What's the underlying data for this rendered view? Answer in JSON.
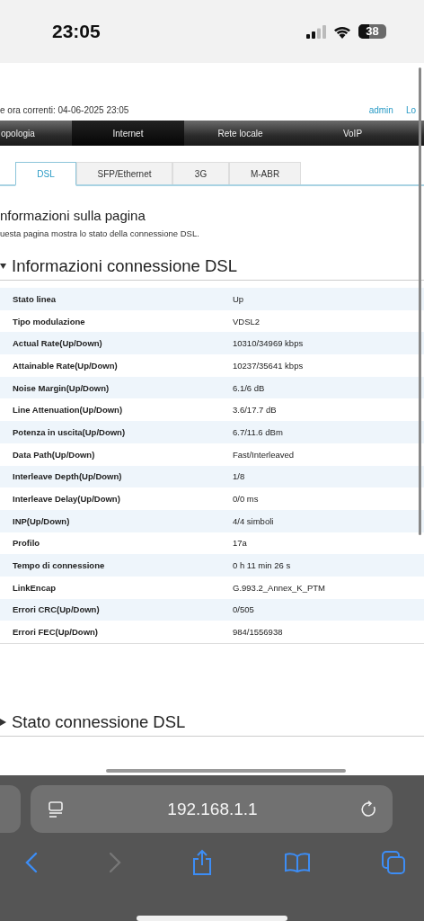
{
  "status_bar": {
    "time": "23:05",
    "battery": "38"
  },
  "header": {
    "datetime": "e ora correnti: 04-06-2025 23:05",
    "links": [
      "admin",
      "Lo"
    ]
  },
  "nav": [
    {
      "label": "opologia",
      "selected": false
    },
    {
      "label": "Internet",
      "selected": true
    },
    {
      "label": "Rete locale",
      "selected": false
    },
    {
      "label": "VoIP",
      "selected": false
    }
  ],
  "tabs": [
    {
      "label": "DSL",
      "selected": true
    },
    {
      "label": "SFP/Ethernet",
      "selected": false
    },
    {
      "label": "3G",
      "selected": false
    },
    {
      "label": "M-ABR",
      "selected": false
    }
  ],
  "info": {
    "title": "nformazioni sulla pagina",
    "description": "uesta pagina mostra lo stato della connessione DSL."
  },
  "sections": [
    {
      "title": "Informazioni connessione DSL",
      "expanded": true,
      "rows": [
        {
          "label": "Stato linea",
          "value": "Up"
        },
        {
          "label": "Tipo modulazione",
          "value": "VDSL2"
        },
        {
          "label": "Actual Rate(Up/Down)",
          "value": "10310/34969 kbps"
        },
        {
          "label": "Attainable Rate(Up/Down)",
          "value": "10237/35641 kbps"
        },
        {
          "label": "Noise Margin(Up/Down)",
          "value": "6.1/6 dB"
        },
        {
          "label": "Line Attenuation(Up/Down)",
          "value": "3.6/17.7 dB"
        },
        {
          "label": "Potenza in uscita(Up/Down)",
          "value": "6.7/11.6 dBm"
        },
        {
          "label": "Data Path(Up/Down)",
          "value": "Fast/Interleaved"
        },
        {
          "label": "Interleave Depth(Up/Down)",
          "value": "1/8"
        },
        {
          "label": "Interleave Delay(Up/Down)",
          "value": "0/0 ms"
        },
        {
          "label": "INP(Up/Down)",
          "value": "4/4 simboli"
        },
        {
          "label": "Profilo",
          "value": "17a"
        },
        {
          "label": "Tempo di connessione",
          "value": "0 h 11 min 26 s"
        },
        {
          "label": "LinkEncap",
          "value": "G.993.2_Annex_K_PTM"
        },
        {
          "label": "Errori CRC(Up/Down)",
          "value": "0/505"
        },
        {
          "label": "Errori FEC(Up/Down)",
          "value": "984/1556938"
        }
      ]
    },
    {
      "title": "Stato connessione DSL",
      "expanded": false
    }
  ],
  "browser": {
    "url": "192.168.1.1"
  }
}
